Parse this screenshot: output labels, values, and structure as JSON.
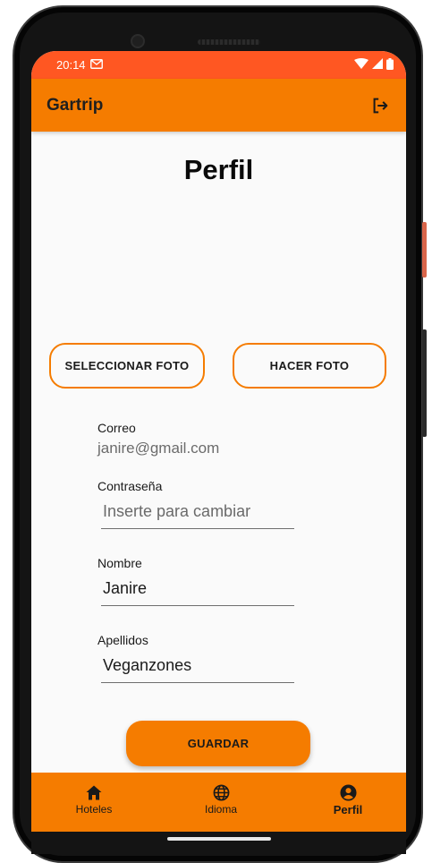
{
  "status_bar": {
    "time": "20:14",
    "notification_icon": "gmail-icon",
    "icons": [
      "wifi-icon",
      "signal-icon",
      "battery-icon"
    ]
  },
  "app_bar": {
    "title": "Gartrip",
    "logout_icon": "logout-icon"
  },
  "page": {
    "title": "Perfil"
  },
  "photo_buttons": {
    "select_label": "SELECCIONAR FOTO",
    "take_label": "HACER FOTO"
  },
  "form": {
    "email": {
      "label": "Correo",
      "value": "janire@gmail.com"
    },
    "password": {
      "label": "Contraseña",
      "value": "",
      "placeholder": "Inserte para cambiar"
    },
    "name": {
      "label": "Nombre",
      "value": "Janire"
    },
    "surname": {
      "label": "Apellidos",
      "value": "Veganzones"
    },
    "save_label": "GUARDAR"
  },
  "bottom_nav": {
    "items": [
      {
        "label": "Hoteles",
        "icon": "home-icon",
        "active": false
      },
      {
        "label": "Idioma",
        "icon": "globe-icon",
        "active": false
      },
      {
        "label": "Perfil",
        "icon": "account-icon",
        "active": true
      }
    ]
  },
  "colors": {
    "status_bar": "#ff5722",
    "primary": "#f57c00",
    "background": "#fafafa"
  }
}
